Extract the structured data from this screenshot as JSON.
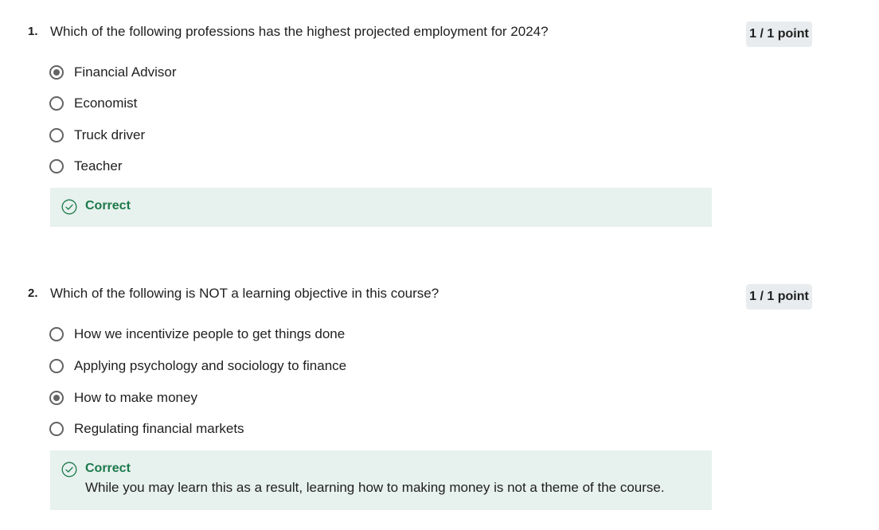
{
  "questions": [
    {
      "number": "1.",
      "text": "Which of the following professions has the highest projected employment for 2024?",
      "points": "1 / 1 point",
      "options": [
        {
          "label": "Financial Advisor",
          "selected": true
        },
        {
          "label": "Economist",
          "selected": false
        },
        {
          "label": "Truck driver",
          "selected": false
        },
        {
          "label": "Teacher",
          "selected": false
        }
      ],
      "feedback": {
        "title": "Correct",
        "explanation": ""
      }
    },
    {
      "number": "2.",
      "text": "Which of the following is NOT a learning objective in this course?",
      "points": "1 / 1 point",
      "options": [
        {
          "label": "How we incentivize people to get things done",
          "selected": false
        },
        {
          "label": "Applying psychology and sociology to finance",
          "selected": false
        },
        {
          "label": "How to make money",
          "selected": true
        },
        {
          "label": "Regulating financial markets",
          "selected": false
        }
      ],
      "feedback": {
        "title": "Correct",
        "explanation": "While you may learn this as a result, learning how to making money is not a theme of the course."
      }
    }
  ],
  "icons": {
    "feedback": "check-circle-icon"
  },
  "colors": {
    "correct_green": "#1c7a4b",
    "feedback_bg": "#e7f1ee",
    "badge_bg": "#e9ecee",
    "radio_gray": "#636363"
  }
}
